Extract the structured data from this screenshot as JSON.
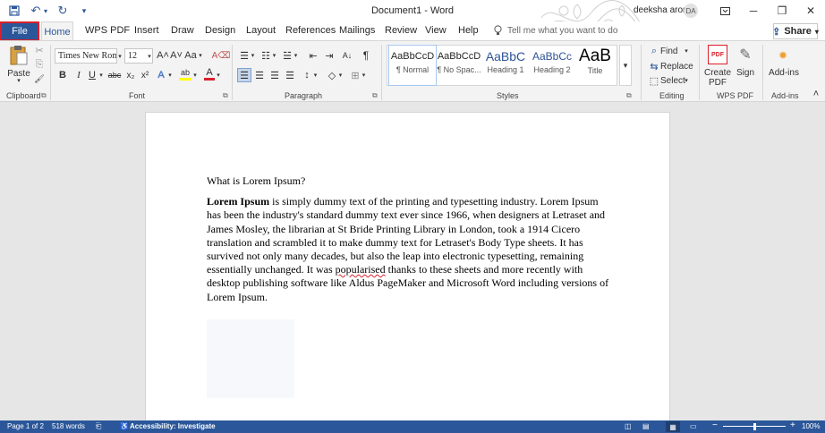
{
  "window": {
    "title": "Document1 - Word",
    "user_name": "deeksha arora",
    "user_initials": "DA",
    "minimize_glyph": "─",
    "restore_glyph": "❐",
    "close_glyph": "✕"
  },
  "qat": {
    "save_icon": "save-icon",
    "undo_glyph": "↶",
    "undo_dropdown_glyph": "▾",
    "redo_glyph": "↻",
    "customize_glyph": "▾"
  },
  "tabs": {
    "file": "File",
    "home": "Home",
    "wps_pdf": "WPS PDF",
    "insert": "Insert",
    "draw": "Draw",
    "design": "Design",
    "layout": "Layout",
    "references": "References",
    "mailings": "Mailings",
    "review": "Review",
    "view": "View",
    "help": "Help",
    "tell_me": "Tell me what you want to do",
    "share": "Share",
    "share_glyph": "⇪",
    "share_dropdown_glyph": "▾"
  },
  "ribbon": {
    "clipboard": {
      "paste": "Paste",
      "paste_dropdown_glyph": "▾",
      "cut_glyph": "✂",
      "copy_glyph": "⎘",
      "painter_glyph": "🖌",
      "label": "Clipboard",
      "launcher_glyph": "⧉"
    },
    "font": {
      "font_name": "Times New Roma",
      "font_size": "12",
      "combo_dropdown_glyph": "▾",
      "grow_glyph": "A˄",
      "shrink_glyph": "A˅",
      "change_case_glyph": "Aa",
      "change_case_dropdown_glyph": "▾",
      "clear_formatting_glyph": "A⌫",
      "bold_glyph": "B",
      "italic_glyph": "I",
      "underline_glyph": "U",
      "underline_dropdown_glyph": "▾",
      "strikethrough_glyph": "abc",
      "subscript_glyph": "x₂",
      "superscript_glyph": "x²",
      "text_effects_glyph": "A",
      "text_effects_dropdown_glyph": "▾",
      "highlight_glyph": "ab",
      "highlight_dropdown_glyph": "▾",
      "font_color_glyph": "A",
      "font_color_dropdown_glyph": "▾",
      "label": "Font",
      "launcher_glyph": "⧉"
    },
    "paragraph": {
      "bullets_glyph": "☰",
      "bullets_dropdown_glyph": "▾",
      "numbering_glyph": "☷",
      "numbering_dropdown_glyph": "▾",
      "multilevel_glyph": "☱",
      "multilevel_dropdown_glyph": "▾",
      "decrease_indent_glyph": "⇤",
      "increase_indent_glyph": "⇥",
      "sort_glyph": "A↓",
      "show_marks_glyph": "¶",
      "align_left_glyph": "☰",
      "align_center_glyph": "☰",
      "align_right_glyph": "☰",
      "justify_glyph": "☰",
      "line_spacing_glyph": "↕",
      "line_spacing_dropdown_glyph": "▾",
      "shading_glyph": "◇",
      "shading_dropdown_glyph": "▾",
      "borders_glyph": "⊞",
      "borders_dropdown_glyph": "▾",
      "label": "Paragraph",
      "launcher_glyph": "⧉"
    },
    "styles": {
      "items": [
        {
          "preview": "AaBbCcD",
          "name": "¶ Normal"
        },
        {
          "preview": "AaBbCcD",
          "name": "¶ No Spac..."
        },
        {
          "preview": "AaBbC",
          "name": "Heading 1"
        },
        {
          "preview": "AaBbCc",
          "name": "Heading 2"
        },
        {
          "preview": "AaB",
          "name": "Title"
        }
      ],
      "more_glyph": "▾",
      "label": "Styles",
      "launcher_glyph": "⧉"
    },
    "editing": {
      "find": "Find",
      "find_glyph": "⌕",
      "find_dropdown_glyph": "▾",
      "replace": "Replace",
      "replace_glyph": "⇆",
      "select": "Select",
      "select_glyph": "⬚",
      "select_dropdown_glyph": "▾",
      "label": "Editing"
    },
    "wps_pdf": {
      "create_pdf": "Create PDF",
      "create_pdf_glyph": "PDF",
      "sign": "Sign",
      "sign_glyph": "✎",
      "label": "WPS PDF"
    },
    "addins": {
      "button": "Add-ins",
      "addins_glyph": "✹",
      "label": "Add-ins"
    },
    "collapse_glyph": "˄"
  },
  "document": {
    "heading": "What is Lorem Ipsum?",
    "body_bold": "Lorem Ipsum",
    "body_part1": " is simply dummy text of the printing and typesetting industry. Lorem Ipsum has been the industry's standard dummy text ever since 1966, when designers at Letraset and James Mosley, the librarian at St Bride Printing Library in London, took a 1914 Cicero translation and scrambled it to make dummy text for Letraset's Body Type sheets. It has survived not only many decades, but also the leap into electronic typesetting, remaining essentially unchanged. It was ",
    "body_misspelled": "popularised",
    "body_part2": " thanks to these sheets and more recently with desktop publishing software like Aldus PageMaker and Microsoft Word including versions of Lorem Ipsum."
  },
  "status": {
    "page": "Page 1 of 2",
    "words": "518 words",
    "proofing_glyph": "⎗",
    "accessibility": "Accessibility: Investigate",
    "accessibility_glyph": "♿",
    "focus_glyph": "◫",
    "read_mode_glyph": "▤",
    "print_layout_glyph": "▦",
    "web_layout_glyph": "▭",
    "zoom_out_glyph": "−",
    "zoom_in_glyph": "+",
    "zoom": "100%",
    "zoom_level_percent": 100
  },
  "colors": {
    "accent": "#2b579a",
    "file_highlight": "#d9202b",
    "ribbon_bg": "#f3f3f3",
    "canvas_bg": "#e6e6e6"
  }
}
